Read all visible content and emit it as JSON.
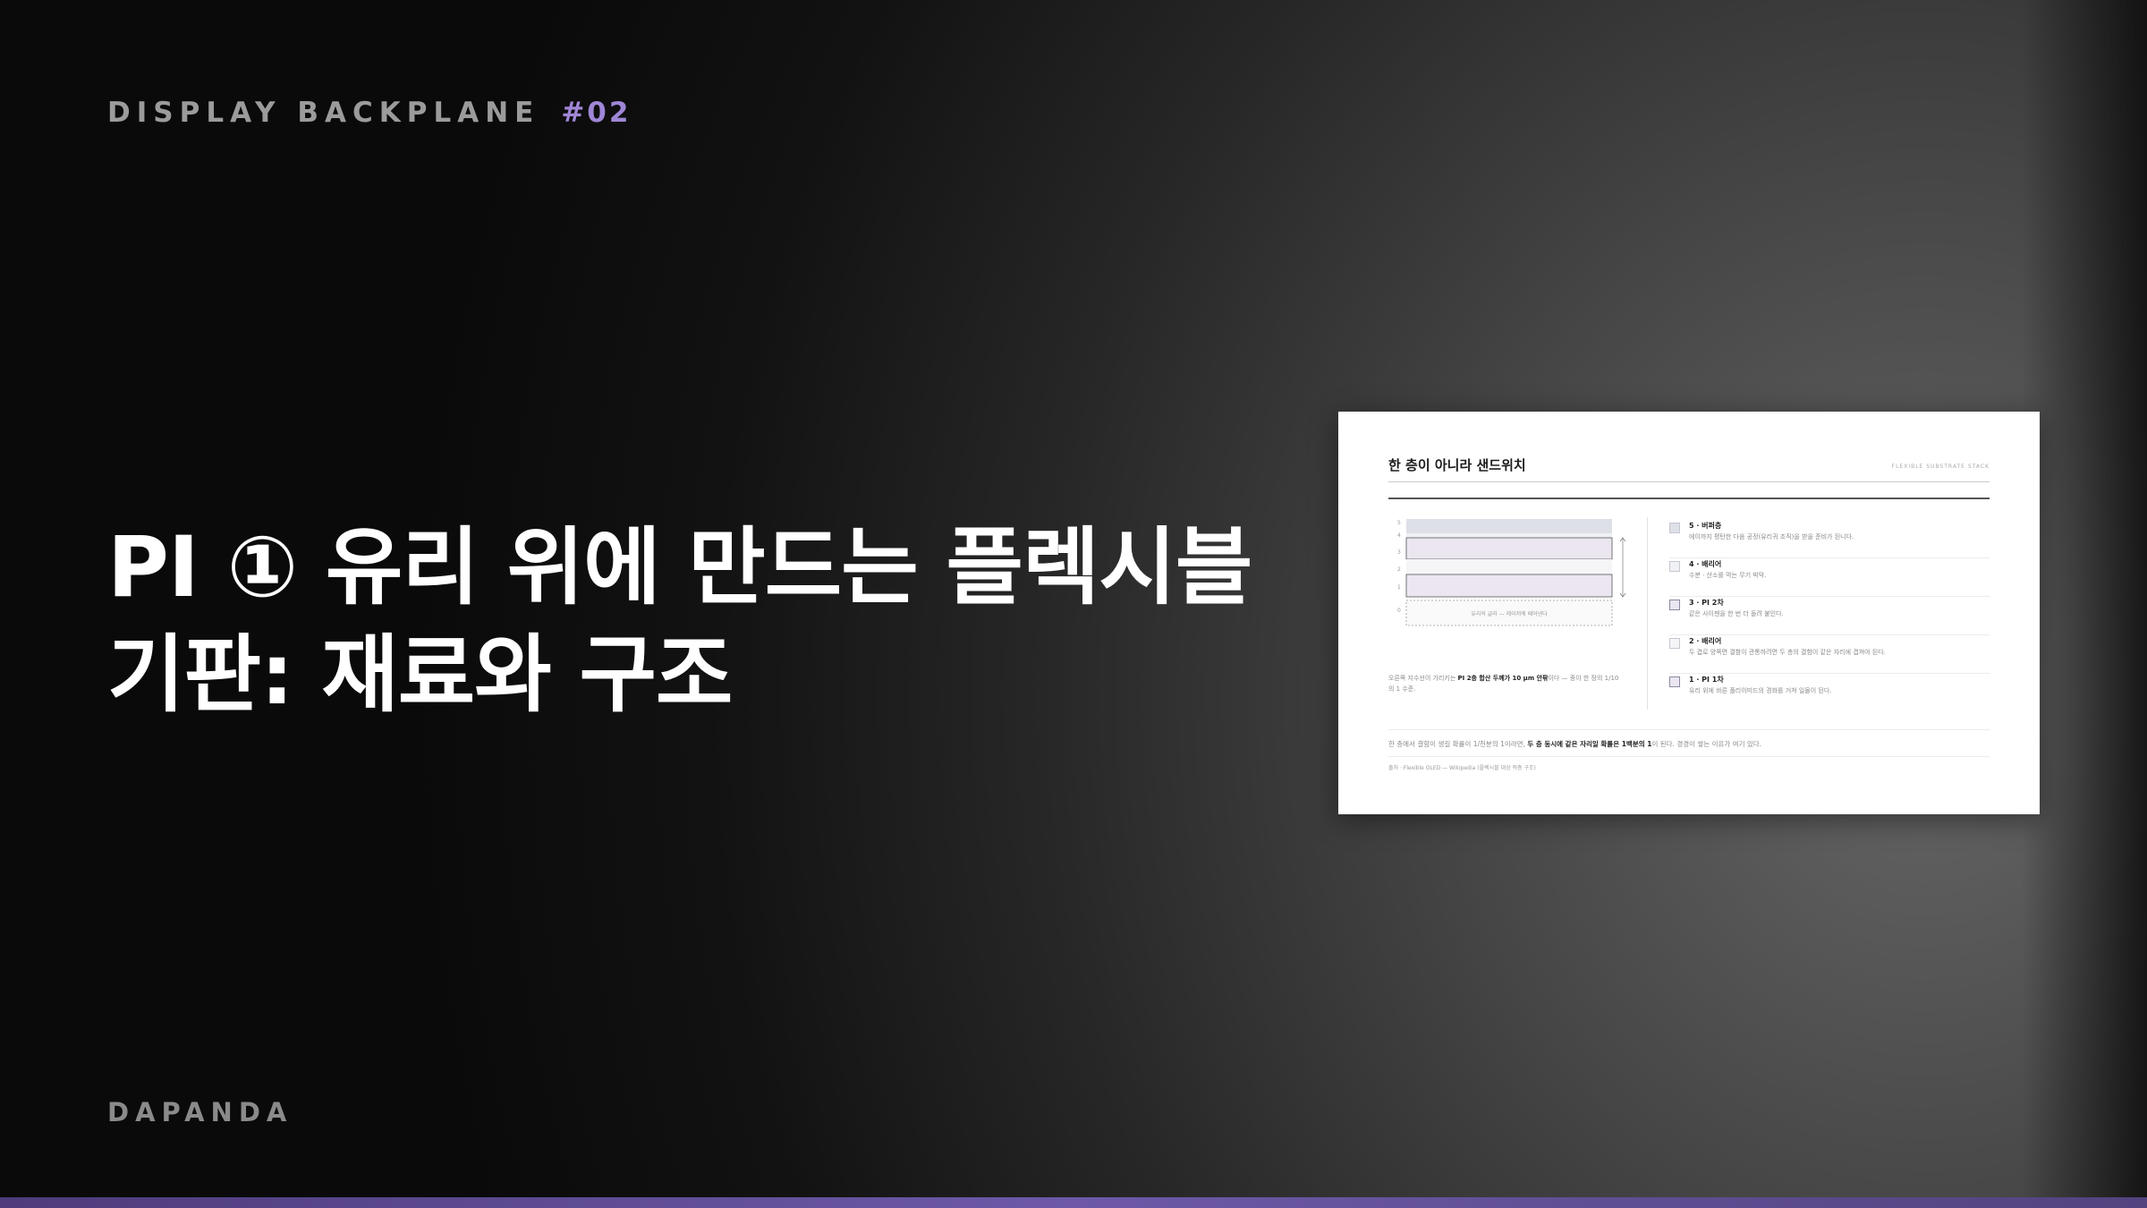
{
  "header": {
    "series": "DISPLAY BACKPLANE",
    "number": "#02"
  },
  "title": "PI ① 유리 위에 만드는 플렉시블 기판: 재료와 구조",
  "brand": "DAPANDA",
  "colors": {
    "accent": "#9f86d6",
    "bottom_bar": "#5b4790",
    "title": "#ffffff",
    "muted": "#9b9b9b"
  },
  "slide_preview": {
    "title": "한 층이 아니라 샌드위치",
    "tag": "FLEXIBLE SUBSTRATE STACK",
    "diagram": {
      "y_labels": [
        "5",
        "4",
        "3",
        "2",
        "1",
        "0"
      ],
      "glass_label": "유리의 글라 — 레이저에 떼어낸다"
    },
    "caption": {
      "pre": "오른쪽 지수선이 가리키는 ",
      "bold": "PI 2층 합산 두께가 10 μm 안팎",
      "post": "이다 — 종이 한 장의 1/10 의 1 수준."
    },
    "layers": [
      {
        "name": "5 · 버퍼층",
        "desc": "에이까지 평탄한 다음 공정(유리귀 조직)을 받을 준비가 된니다."
      },
      {
        "name": "4 · 배리어",
        "desc": "수분 · 산소를 막는 무기 박막."
      },
      {
        "name": "3 · PI 2차",
        "desc": "같은 사이젠을 한 번 더 돌려 붙인다."
      },
      {
        "name": "2 · 배리어",
        "desc": "두 겹로 양쪽면 결함이 관통하려면 두 층의 결함이 같은 자리에 겹쳐야 된다."
      },
      {
        "name": "1 · PI 1차",
        "desc": "유리 위에 바른 폴리이미드의 경화를 거쳐 일몰이 된다."
      }
    ],
    "bottom_text": {
      "pre": "한 층에서 결함이 생길 확률이 1/천분의 1이라면, ",
      "bold": "두 층 동시에 같은 자리일 확률은 1백분의 1",
      "post": "이 된다. 경경이 쌓는 이유가 여기 있다."
    },
    "source": "출처 · Flexible OLED — Wikipedia (플렉시블 대상 적층 구조)"
  }
}
